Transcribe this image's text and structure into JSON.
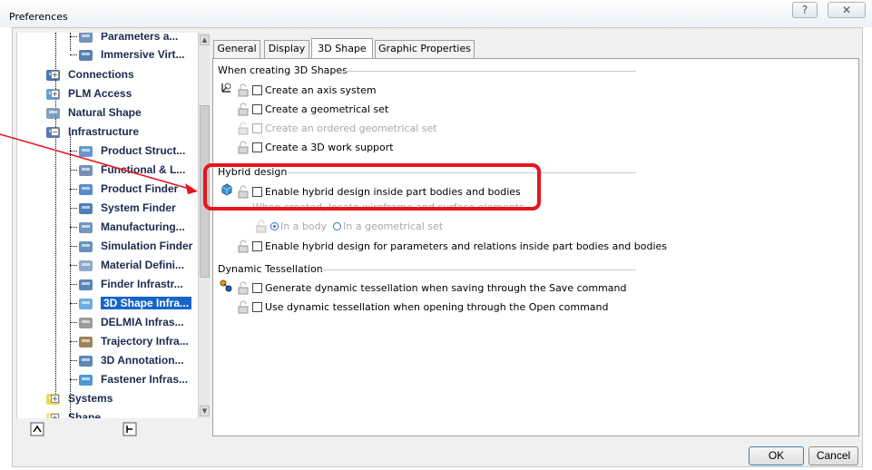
{
  "window": {
    "title": "Preferences",
    "help_glyph": "?",
    "close_glyph": "✕"
  },
  "tree": {
    "items": [
      {
        "label": "Parameters a...",
        "icon": "parameters-icon"
      },
      {
        "label": "Immersive Virt...",
        "icon": "immersive-icon"
      },
      {
        "label": "Connections",
        "icon": "connections-icon"
      },
      {
        "label": "PLM Access",
        "icon": "plm-access-icon"
      },
      {
        "label": "Natural Shape",
        "icon": "natural-shape-icon"
      },
      {
        "label": "Infrastructure",
        "icon": "infrastructure-icon"
      },
      {
        "label": "Product Struct...",
        "icon": "product-structure-icon"
      },
      {
        "label": "Functional & L...",
        "icon": "functional-icon"
      },
      {
        "label": "Product Finder",
        "icon": "product-finder-icon"
      },
      {
        "label": "System Finder",
        "icon": "system-finder-icon"
      },
      {
        "label": "Manufacturing...",
        "icon": "manufacturing-icon"
      },
      {
        "label": "Simulation Finder",
        "icon": "simulation-finder-icon"
      },
      {
        "label": "Material Defini...",
        "icon": "material-icon"
      },
      {
        "label": "Finder Infrastr...",
        "icon": "finder-infra-icon"
      },
      {
        "label": "3D Shape Infra...",
        "icon": "shape-infra-icon",
        "selected": true
      },
      {
        "label": "DELMIA Infras...",
        "icon": "delmia-icon"
      },
      {
        "label": "Trajectory Infra...",
        "icon": "trajectory-icon"
      },
      {
        "label": "3D Annotation...",
        "icon": "annotation-icon"
      },
      {
        "label": "Fastener Infras...",
        "icon": "fastener-icon"
      },
      {
        "label": "Systems",
        "icon": "systems-icon"
      },
      {
        "label": "Shape",
        "icon": "shape-icon"
      }
    ]
  },
  "tabs": [
    "General",
    "Display",
    "3D Shape",
    "Graphic Properties"
  ],
  "active_tab": "3D Shape",
  "sections": {
    "creating": {
      "title": "When creating 3D Shapes",
      "options": [
        "Create an axis system",
        "Create a geometrical set",
        "Create an ordered geometrical set",
        "Create a 3D work support"
      ]
    },
    "hybrid": {
      "title": "Hybrid design",
      "enable": "Enable hybrid design inside part bodies and bodies",
      "locate_label": "When created, locate wireframe and surface elements",
      "radio_body": "In a body",
      "radio_geoset": "In a geometrical set",
      "params": "Enable hybrid design for parameters and relations inside part bodies and bodies"
    },
    "tessellation": {
      "title": "Dynamic Tessellation",
      "save": "Generate dynamic tessellation when saving through the Save command",
      "open": "Use dynamic tessellation when opening through the Open command"
    }
  },
  "buttons": {
    "ok": "OK",
    "cancel": "Cancel"
  },
  "colors": {
    "highlight": "#e8141e",
    "selection": "#1565c9"
  }
}
